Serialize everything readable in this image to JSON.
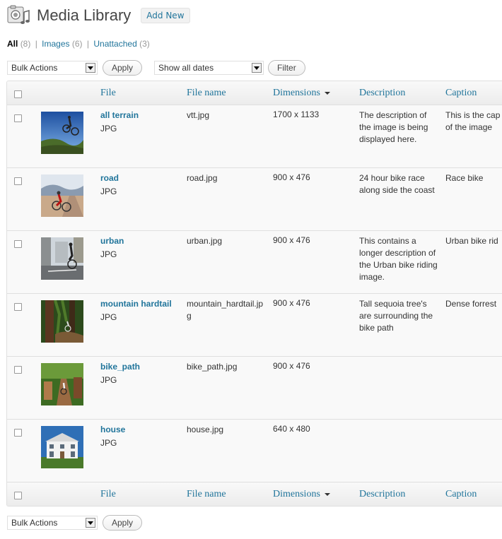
{
  "header": {
    "title": "Media Library",
    "add_new": "Add New"
  },
  "filters": {
    "all_label": "All",
    "all_count": "(8)",
    "images_label": "Images",
    "images_count": "(6)",
    "unattached_label": "Unattached",
    "unattached_count": "(3)",
    "separator": "|"
  },
  "top_nav": {
    "bulk_actions": "Bulk Actions",
    "apply": "Apply",
    "dates": "Show all dates",
    "filter": "Filter"
  },
  "bottom_nav": {
    "bulk_actions": "Bulk Actions",
    "apply": "Apply"
  },
  "columns": {
    "file": "File",
    "file_name": "File name",
    "dimensions": "Dimensions",
    "description": "Description",
    "caption": "Caption"
  },
  "rows": [
    {
      "title": "all terrain",
      "type": "JPG",
      "file_name": "vtt.jpg",
      "dimensions": "1700 x 1133",
      "description": "The description of the image is being displayed here.",
      "caption": "This is the cap of the image"
    },
    {
      "title": "road",
      "type": "JPG",
      "file_name": "road.jpg",
      "dimensions": "900 x 476",
      "description": "24 hour bike race along side the coast",
      "caption": "Race bike"
    },
    {
      "title": "urban",
      "type": "JPG",
      "file_name": "urban.jpg",
      "dimensions": "900 x 476",
      "description": "This contains a longer description of the Urban bike riding image.",
      "caption": "Urban bike rid"
    },
    {
      "title": "mountain hardtail",
      "type": "JPG",
      "file_name": "mountain_hardtail.jpg",
      "dimensions": "900 x 476",
      "description": "Tall sequoia tree's are surrounding the bike path",
      "caption": "Dense forrest"
    },
    {
      "title": "bike_path",
      "type": "JPG",
      "file_name": "bike_path.jpg",
      "dimensions": "900 x 476",
      "description": "",
      "caption": ""
    },
    {
      "title": "house",
      "type": "JPG",
      "file_name": "house.jpg",
      "dimensions": "640 x 480",
      "description": "",
      "caption": ""
    }
  ],
  "colors": {
    "link": "#21759b",
    "border": "#dfdfdf",
    "row_bg": "#f9f9f9"
  }
}
